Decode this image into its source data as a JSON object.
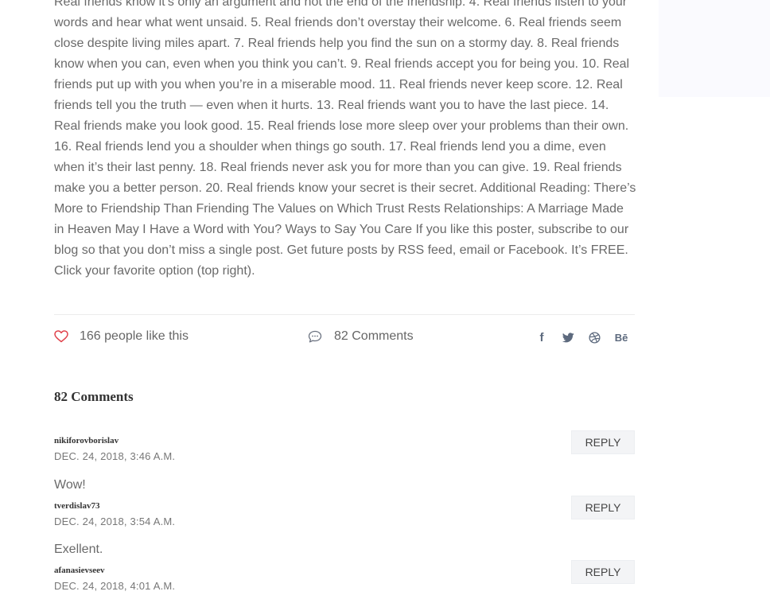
{
  "article": {
    "body": "Real friends know it’s only an argument and not the end of the friendship. 4. Real friends listen to your words and hear what went unsaid. 5. Real friends don’t overstay their welcome. 6. Real friends seem close despite living miles apart. 7. Real friends help you find the sun on a stormy day. 8. Real friends know when you can, even when you think you can’t. 9. Real friends accept you for being you. 10. Real friends put up with you when you’re in a miserable mood. 11. Real friends never keep score. 12. Real friends tell you the truth — even when it hurts. 13. Real friends want you to have the last piece. 14. Real friends make you look good. 15. Real friends lose more sleep over your problems than their own. 16. Real friends lend you a shoulder when things go south. 17. Real friends lend you a dime, even when it’s their last penny. 18. Real friends never ask you for more than you can give. 19. Real friends make you a better person. 20. Real friends know your secret is their secret. Additional Reading: There’s More to Friendship Than Friending The Values on Which Trust Rests Relationships: A Marriage Made in Heaven May I Have a Word with You? Ways to Say You Care If you like this poster, subscribe to our blog so that you don’t miss a single post. Get future posts by RSS feed, email or Facebook. It’s FREE. Click your favorite option (top right)."
  },
  "meta": {
    "likes_label": "166 people like this",
    "comments_label": "82 Comments",
    "social_icons": {
      "facebook": "f",
      "twitter": "twitter-icon",
      "dribbble": "dribbble-icon",
      "behance": "Bē"
    }
  },
  "comments_section": {
    "title": "82 Comments",
    "reply_label": "REPLY",
    "items": [
      {
        "author": "nikiforovborislav",
        "date": "DEC. 24, 2018, 3:46 A.M.",
        "text": "Wow!"
      },
      {
        "author": "tverdislav73",
        "date": "DEC. 24, 2018, 3:54 A.M.",
        "text": "Exellent."
      },
      {
        "author": "afanasievseev",
        "date": "DEC. 24, 2018, 4:01 A.M.",
        "text": ""
      }
    ]
  },
  "colors": {
    "heart": "#e0424b",
    "social": "#5d6a7e",
    "sidebar_bg": "#fafafe"
  }
}
